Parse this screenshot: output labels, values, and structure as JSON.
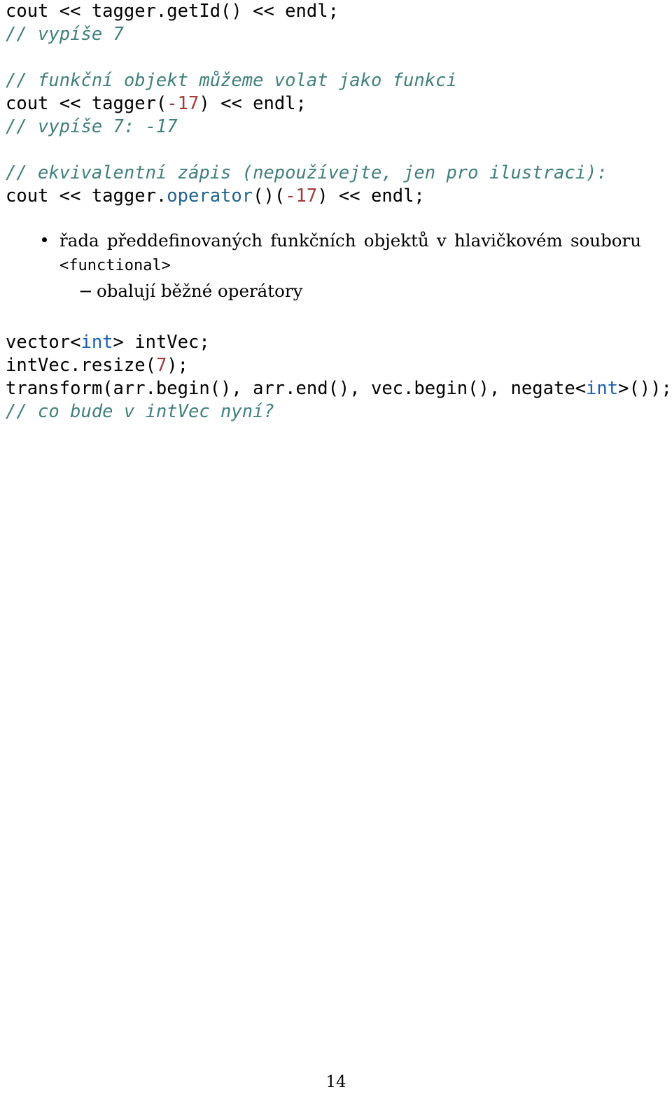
{
  "document": {
    "page_number": "14",
    "code_block_1": {
      "lines": [
        [
          {
            "t": "cout << tagger.getId() << endl;",
            "s": "plain"
          }
        ],
        [
          {
            "t": "// vypíše 7",
            "s": "comment"
          }
        ],
        [
          {
            "t": "",
            "s": "plain"
          }
        ],
        [
          {
            "t": "// funkční objekt můžeme volat jako funkci",
            "s": "comment"
          }
        ],
        [
          {
            "t": "cout << tagger(",
            "s": "plain"
          },
          {
            "t": "-17",
            "s": "number"
          },
          {
            "t": ") << endl;",
            "s": "plain"
          }
        ],
        [
          {
            "t": "// vypíše 7: -17",
            "s": "comment"
          }
        ],
        [
          {
            "t": "",
            "s": "plain"
          }
        ],
        [
          {
            "t": "// ekvivalentní zápis (nepoužívejte, jen pro ilustraci):",
            "s": "comment"
          }
        ],
        [
          {
            "t": "cout << tagger.",
            "s": "plain"
          },
          {
            "t": "operator",
            "s": "function"
          },
          {
            "t": "()(",
            "s": "plain"
          },
          {
            "t": "-17",
            "s": "number"
          },
          {
            "t": ") << endl;",
            "s": "plain"
          }
        ]
      ]
    },
    "bullet": {
      "text_before": "řada předdefinovaných funkčních objektů v hlavičkovém souboru",
      "code_inline": "<functional>",
      "subitem_dash": "−",
      "subitem_text": "obalují běžné operátory"
    },
    "code_block_2": {
      "lines": [
        [
          {
            "t": "vector<",
            "s": "plain"
          },
          {
            "t": "int",
            "s": "keyword"
          },
          {
            "t": "> intVec;",
            "s": "plain"
          }
        ],
        [
          {
            "t": "intVec.resize(",
            "s": "plain"
          },
          {
            "t": "7",
            "s": "number"
          },
          {
            "t": ");",
            "s": "plain"
          }
        ],
        [
          {
            "t": "transform(arr.begin(), arr.end(), vec.begin(), negate<",
            "s": "plain"
          },
          {
            "t": "int",
            "s": "keyword"
          },
          {
            "t": ">());",
            "s": "plain"
          }
        ],
        [
          {
            "t": "// co bude v intVec nyní?",
            "s": "comment"
          }
        ]
      ]
    }
  },
  "colors": {
    "comment": "#3f7f7f",
    "keyword": "#1a5fb4",
    "number": "#a33b3b",
    "function": "#20638f",
    "text": "#000000",
    "background": "#ffffff"
  }
}
